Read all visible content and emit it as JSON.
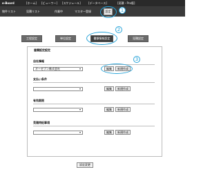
{
  "topnav": {
    "brand": "e-Board",
    "menu": [
      "[ホーム]",
      "[ビューワー]",
      "[スケジュール]",
      "[データベース]",
      "[見積・Pro版]"
    ],
    "gear_label": "設定"
  },
  "subnav": {
    "items": [
      "物件リスト",
      "見積リスト",
      "作業中",
      "マスター登録"
    ]
  },
  "callouts": {
    "one": "1",
    "two": "2",
    "three": "3"
  },
  "tabs": [
    "工程設定",
    "単位設定",
    "書類情報設定",
    "見積設定"
  ],
  "page_title": "書類設定設定",
  "sections": [
    {
      "label": "自社情報",
      "select_value": "オーセブン株式会社",
      "edit_label": "編集",
      "new_label": "新規作成"
    },
    {
      "label": "支払い条件",
      "select_value": "",
      "edit_label": "編集",
      "new_label": "新規作成"
    },
    {
      "label": "有効期限",
      "select_value": "",
      "edit_label": "編集",
      "new_label": "新規作成"
    },
    {
      "label": "見積特記事項",
      "select_value": "",
      "edit_label": "編集",
      "new_label": "新規作成"
    }
  ],
  "submit_label": "設定変更",
  "colors": {
    "topbar": "#2a2a2a",
    "accent": "#27a3d8"
  }
}
